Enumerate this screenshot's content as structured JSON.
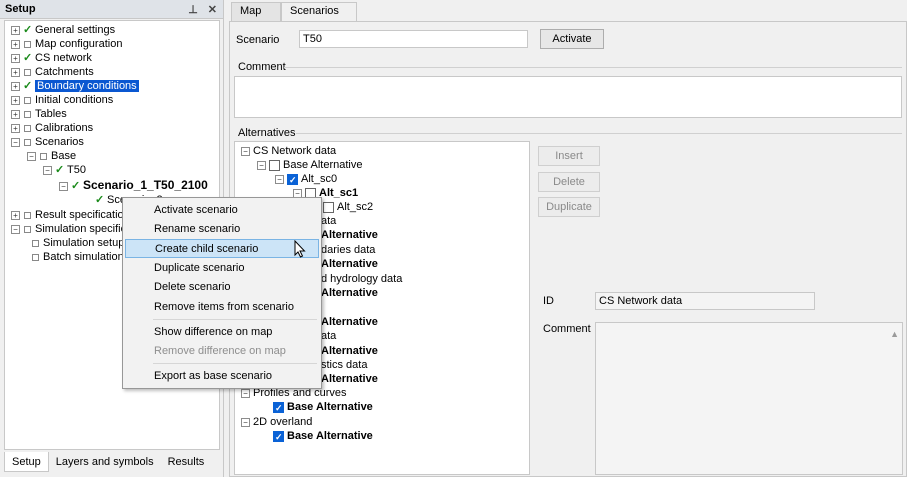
{
  "setup_panel": {
    "title": "Setup",
    "pin_icon": "pin-icon",
    "close_icon": "close-icon",
    "tree": [
      {
        "label": "General settings",
        "checked": true
      },
      {
        "label": "Map configuration",
        "checked": false
      },
      {
        "label": "CS network",
        "checked": true
      },
      {
        "label": "Catchments",
        "checked": false
      },
      {
        "label": "Boundary conditions",
        "checked": true,
        "selected": true
      },
      {
        "label": "Initial conditions",
        "checked": false
      },
      {
        "label": "Tables",
        "checked": false
      },
      {
        "label": "Calibrations",
        "checked": false
      },
      {
        "label": "Scenarios",
        "checked": false
      },
      {
        "label": "Base",
        "checked": false
      },
      {
        "label": "T50",
        "checked": true
      },
      {
        "label": "Scenario_1_T50_2100",
        "checked": true
      },
      {
        "label": "Scenario_2",
        "checked": true
      },
      {
        "label": "Result specification",
        "checked": false
      },
      {
        "label": "Simulation specification",
        "checked": false
      },
      {
        "label": "Simulation setup",
        "checked": false
      },
      {
        "label": "Batch simulation",
        "checked": false
      }
    ],
    "bottom_tabs": [
      "Setup",
      "Layers and symbols",
      "Results"
    ]
  },
  "context_menu": {
    "items": [
      "Activate scenario",
      "Rename scenario",
      "Create child scenario",
      "Duplicate scenario",
      "Delete scenario",
      "Remove items from scenario",
      "Show difference on map",
      "Remove difference on map",
      "Export as base scenario"
    ],
    "highlighted": "Create child scenario"
  },
  "tabs": {
    "map": "Map",
    "scenarios": "Scenarios",
    "close_glyph": "✕"
  },
  "scenario_form": {
    "scenario_label": "Scenario",
    "scenario_value": "T50",
    "activate_button": "Activate",
    "comment_label": "Comment",
    "alternatives_label": "Alternatives",
    "insert_button": "Insert",
    "delete_button": "Delete",
    "duplicate_button": "Duplicate",
    "id_label": "ID",
    "id_value": "CS Network data",
    "detail_comment_label": "Comment"
  },
  "alternatives_tree": [
    {
      "label": "CS Network data"
    },
    {
      "label": "Base Alternative"
    },
    {
      "label": "Alt_sc0"
    },
    {
      "label": "Alt_sc1"
    },
    {
      "label": "Alt_sc2"
    },
    {
      "label": "ata"
    },
    {
      "label": "Alternative"
    },
    {
      "label": "daries data"
    },
    {
      "label": "Alternative"
    },
    {
      "label": "d hydrology data"
    },
    {
      "label": "Alternative"
    },
    {
      "label": "Alternative"
    },
    {
      "label": "ata"
    },
    {
      "label": "Alternative"
    },
    {
      "label": "stics data"
    },
    {
      "label": "Alternative"
    },
    {
      "label": "Profiles and curves"
    },
    {
      "label": "Base Alternative"
    },
    {
      "label": "2D overland"
    },
    {
      "label": "Base Alternative"
    }
  ]
}
